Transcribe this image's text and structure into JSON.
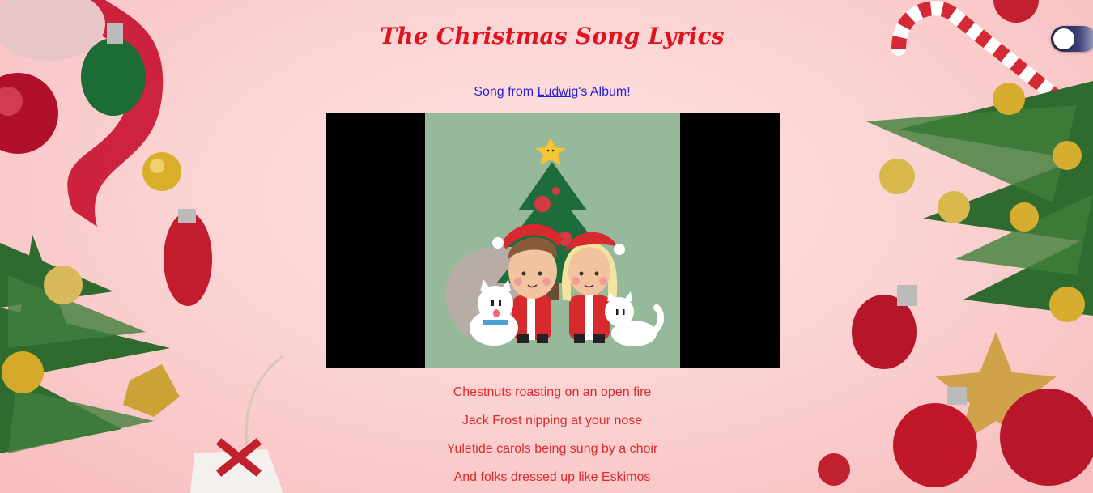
{
  "page": {
    "title": "The Christmas Song Lyrics"
  },
  "subtitle": {
    "prefix": "Song from ",
    "link_text": "Ludwig",
    "suffix": "'s Album!"
  },
  "video": {
    "thumbnail": "christmas-cartoon-thumbnail"
  },
  "lyrics": [
    "Chestnuts roasting on an open fire",
    "Jack Frost nipping at your nose",
    "Yuletide carols being sung by a choir",
    "And folks dressed up like Eskimos"
  ],
  "theme_toggle": {
    "state": "off"
  },
  "colors": {
    "title": "#e0141e",
    "subtitle": "#2a1fd8",
    "lyrics": "#de2a2a",
    "background": "#fbd0d0"
  }
}
